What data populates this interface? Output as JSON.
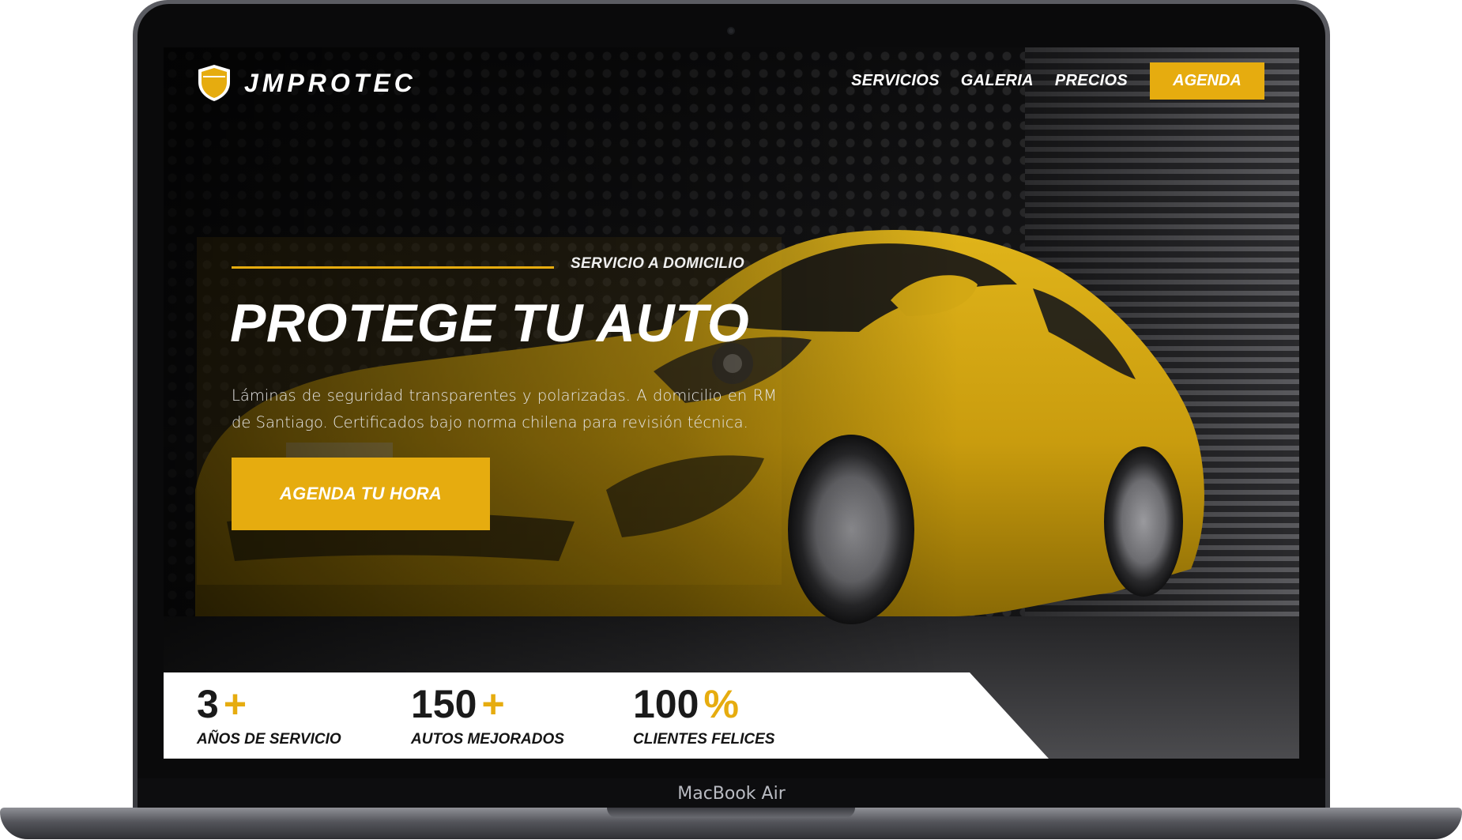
{
  "device": {
    "label": "MacBook Air"
  },
  "brand": {
    "name": "JMPROTEC",
    "logo_icon": "shield-icon",
    "accent_color": "#e6ac0f"
  },
  "nav": {
    "items": [
      {
        "label": "SERVICIOS"
      },
      {
        "label": "GALERIA"
      },
      {
        "label": "PRECIOS"
      }
    ],
    "cta_label": "AGENDA"
  },
  "hero": {
    "kicker": "SERVICIO A DOMICILIO",
    "title": "PROTEGE TU AUTO",
    "description": "Láminas de seguridad transparentes y polarizadas. A domicilio en RM de Santiago. Certificados bajo norma chilena para revisión técnica.",
    "cta_label": "AGENDA TU HORA"
  },
  "stats": [
    {
      "value": "3",
      "suffix": "+",
      "label": "AÑOS DE SERVICIO"
    },
    {
      "value": "150",
      "suffix": "+",
      "label": "AUTOS MEJORADOS"
    },
    {
      "value": "100",
      "suffix": "%",
      "label": "CLIENTES FELICES"
    }
  ]
}
